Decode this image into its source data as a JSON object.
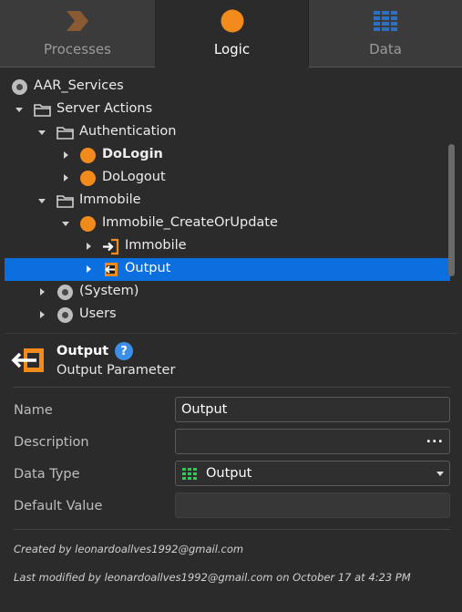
{
  "tabs": [
    {
      "label": "Processes",
      "icon": "process-chevron-icon",
      "active": false
    },
    {
      "label": "Logic",
      "icon": "logic-circle-icon",
      "active": true
    },
    {
      "label": "Data",
      "icon": "data-grid-icon",
      "active": false
    }
  ],
  "tree": {
    "items": [
      {
        "label": "AAR_Services",
        "icon": "module-icon",
        "expanded": true
      },
      {
        "label": "Server Actions",
        "icon": "folder-icon",
        "expanded": true
      },
      {
        "label": "Authentication",
        "icon": "folder-icon",
        "expanded": true
      },
      {
        "label": "DoLogin",
        "icon": "action-icon",
        "expanded": false,
        "bold": true
      },
      {
        "label": "DoLogout",
        "icon": "action-icon",
        "expanded": false
      },
      {
        "label": "Immobile",
        "icon": "folder-icon",
        "expanded": true
      },
      {
        "label": "Immobile_CreateOrUpdate",
        "icon": "action-icon",
        "expanded": true
      },
      {
        "label": "Immobile",
        "icon": "input-parameter-icon",
        "expanded": false
      },
      {
        "label": "Output",
        "icon": "output-parameter-icon",
        "expanded": false,
        "selected": true
      },
      {
        "label": "(System)",
        "icon": "module-icon",
        "expanded": false
      },
      {
        "label": "Users",
        "icon": "module-icon",
        "expanded": false
      }
    ]
  },
  "properties": {
    "title": "Output",
    "subtitle": "Output Parameter",
    "help_symbol": "?",
    "fields": {
      "name": {
        "label": "Name",
        "value": "Output"
      },
      "description": {
        "label": "Description",
        "value": "",
        "button": "..."
      },
      "data_type": {
        "label": "Data Type",
        "value": "Output",
        "icon": "entity-icon"
      },
      "default_value": {
        "label": "Default Value",
        "value": ""
      }
    },
    "created_by": "Created by leonardoallves1992@gmail.com",
    "last_modified": "Last modified by leonardoallves1992@gmail.com on October 17 at 4:23 PM"
  },
  "colors": {
    "accent_orange": "#f28a1c",
    "selection_blue": "#0b6fe0",
    "help_blue": "#3d8ee6",
    "entity_green": "#34c759",
    "data_blue": "#2f6fc0",
    "process_brown": "#8a5a33"
  }
}
